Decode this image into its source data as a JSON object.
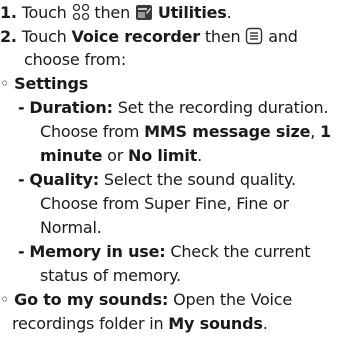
{
  "steps": {
    "step1": {
      "num": "1.",
      "text_a": "Touch",
      "text_b": "then",
      "bold": "Utilities",
      "end": "."
    },
    "step2": {
      "num": "2.",
      "text_a": "Touch",
      "bold": "Voice recorder",
      "text_b": "then",
      "text_c": "and",
      "cont": "choose from:"
    }
  },
  "bullets": {
    "settings": {
      "marker": "◦",
      "label": "Settings"
    },
    "duration": {
      "dash": "-",
      "label": "Duration:",
      "text1": "Set the recording duration.",
      "text2": "Choose from",
      "opt1": "MMS message size",
      "sep": ",",
      "opt2a": "1",
      "opt2b": "minute",
      "or": "or",
      "opt3": "No limit",
      "end": "."
    },
    "quality": {
      "dash": "-",
      "label": "Quality:",
      "text1": "Select the sound quality.",
      "text2": "Choose from Super Fine, Fine or",
      "text3": "Normal."
    },
    "memory": {
      "dash": "-",
      "label": "Memory in use:",
      "text1": "Check the current",
      "text2": "status of memory."
    },
    "sounds": {
      "marker": "◦",
      "label": "Go to my sounds:",
      "text1": "Open the Voice",
      "text2": "recordings folder in",
      "bold2": "My sounds",
      "end": "."
    }
  },
  "icons": {
    "menu": "menu-grid-icon",
    "utilities": "utilities-icon",
    "options": "options-menu-icon"
  }
}
